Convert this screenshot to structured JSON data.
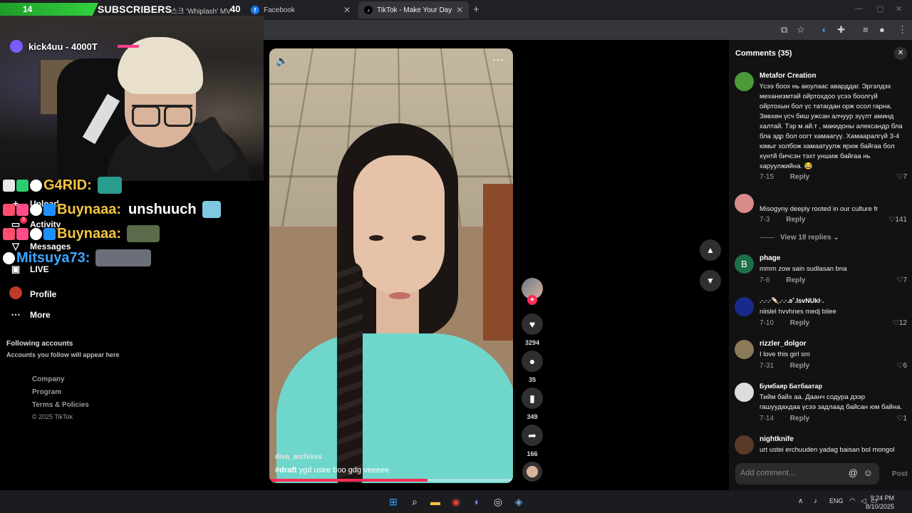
{
  "browser": {
    "tabs": [
      {
        "label": "스크 'Whiplash' MV -",
        "icon": "youtube-icon"
      },
      {
        "label": "Facebook",
        "icon": "facebook-icon"
      },
      {
        "label": "TikTok - Make Your Day",
        "icon": "tiktok-icon",
        "active": true
      }
    ],
    "new_tab": "+"
  },
  "overlay": {
    "sub_count": "14",
    "sub_label": "SUBSCRIBERS",
    "sub_goal": "40",
    "donation_user": "kick4uu - 4000T",
    "chat": [
      {
        "user": "G4RID:",
        "user_color": "#f5c542",
        "message": ""
      },
      {
        "user": "Buynaaa:",
        "user_color": "#f5c542",
        "message": "unshuuch"
      },
      {
        "user": "Buynaaa:",
        "user_color": "#f5c542",
        "message": ""
      },
      {
        "user": "Mitsuya73:",
        "user_color": "#3ea6ff",
        "message": ""
      }
    ]
  },
  "sidebar": {
    "items": [
      {
        "label": "Upload",
        "icon": "upload-icon"
      },
      {
        "label": "Activity",
        "icon": "activity-icon",
        "badge": "3"
      },
      {
        "label": "Messages",
        "icon": "messages-icon"
      },
      {
        "label": "LIVE",
        "icon": "live-icon"
      },
      {
        "label": "Profile",
        "icon": "profile-avatar-icon"
      },
      {
        "label": "More",
        "icon": "more-dots-icon"
      }
    ],
    "following_title": "Following accounts",
    "following_sub": "Accounts you follow will appear here",
    "footer": [
      "Company",
      "Program",
      "Terms & Policies",
      "© 2025 TikTok"
    ]
  },
  "video": {
    "author": "diva_archives",
    "caption_tag": "#draft",
    "caption_text": "ygd usee boo gdg veeeee",
    "progress": 0.65,
    "likes": "3294",
    "comments": "35",
    "saves": "349",
    "shares": "166"
  },
  "comments_panel": {
    "title": "Comments (35)",
    "view_replies": "View 18 replies",
    "input_placeholder": "Add comment...",
    "post_label": "Post",
    "reply_label": "Reply",
    "items": [
      {
        "name": "Metafor Creation",
        "text": "Үсээ боох нь аюулаас аварддаг. Эргэлдэх механизмтай ойртохдоо үсээ боолгүй ойртохын бол үс татагдан орж осол гарна. Зөвхөн үсч биш ужсан алчуур зүүлт аминд халтай. Тэр м.ай.т , макидоны александр бла бла эдр бол оогт хамаагүү. Хамааралгүй 3-4 юмыг холбож хамаатуулж яриж байгаа бол хүнтй бичсэн тэхт уншиж байгаа нь харуулжийна. 😂",
        "date": "7-15",
        "likes": "7",
        "avatar": "#4a9a3a"
      },
      {
        "name": "",
        "text": "Misogyny deeply rooted in our culture fr",
        "date": "7-3",
        "likes": "141",
        "avatar": "#d98a8a"
      },
      {
        "name": "phage",
        "text": "mmm zow sain sudlasan bna",
        "date": "7-6",
        "likes": "7",
        "avatar": "#1f6f4a",
        "initial": "B"
      },
      {
        "name": ".·.·.·🍡.·.·.ʚ˚.IsvNUkI·.",
        "text": "niislel hvvhnes medj bilee",
        "date": "7-10",
        "likes": "12",
        "avatar": "#1a2a8a"
      },
      {
        "name": "rizzler_dolgor",
        "text": "I love this girl sm",
        "date": "7-31",
        "likes": "6",
        "avatar": "#8a7a5a"
      },
      {
        "name": "Бумбаяр Батбаатар",
        "text": "Тийм байх аа. Даанч содура дээр гашуудахдаа үсээ задлаад байсан юм байна.",
        "date": "7-14",
        "likes": "1",
        "avatar": "#dddddd"
      },
      {
        "name": "nightknife",
        "text": "urt ustei erchuuden yadag baisan bol mongol",
        "date": "",
        "likes": "",
        "avatar": "#5a3a2a"
      }
    ]
  },
  "taskbar": {
    "lang": "ENG",
    "time": "9:24 PM",
    "date": "8/10/2025"
  }
}
